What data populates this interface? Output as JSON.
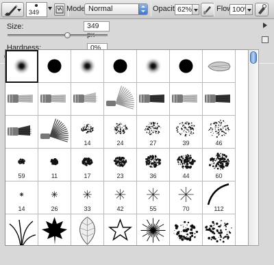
{
  "toolbar": {
    "tool_icon": "brush-icon",
    "brush_size_preview": "349",
    "mode_label": "Mode:",
    "mode_value": "Normal",
    "opacity_label": "Opacity:",
    "opacity_value": "62%",
    "flow_label": "Flow:",
    "flow_value": "100%",
    "airbrush_icon": "airbrush-icon"
  },
  "panel": {
    "size_label": "Size:",
    "size_value": "349 px",
    "size_slider_level": 0.6,
    "hardness_label": "Hardness:",
    "hardness_value": "0%",
    "hardness_slider_level": 0.0
  },
  "brushes": [
    {
      "kind": "soft",
      "label": ""
    },
    {
      "kind": "hard",
      "label": ""
    },
    {
      "kind": "soft",
      "label": ""
    },
    {
      "kind": "hard",
      "label": ""
    },
    {
      "kind": "soft",
      "label": ""
    },
    {
      "kind": "hard",
      "label": ""
    },
    {
      "kind": "bristle-tip",
      "label": ""
    },
    {
      "kind": "flat-brush",
      "label": ""
    },
    {
      "kind": "flat-brush",
      "label": ""
    },
    {
      "kind": "angled-brush",
      "label": ""
    },
    {
      "kind": "fan-brush",
      "label": ""
    },
    {
      "kind": "flat-brush-dark",
      "label": ""
    },
    {
      "kind": "flat-brush",
      "label": ""
    },
    {
      "kind": "flat-brush-dark",
      "label": ""
    },
    {
      "kind": "angled-brush-dark",
      "label": ""
    },
    {
      "kind": "fan-brush-dark",
      "label": ""
    },
    {
      "kind": "spray",
      "label": "14"
    },
    {
      "kind": "spray",
      "label": "24"
    },
    {
      "kind": "spray",
      "label": "27"
    },
    {
      "kind": "spray",
      "label": "39"
    },
    {
      "kind": "spray",
      "label": "46"
    },
    {
      "kind": "spray",
      "label": "59"
    },
    {
      "kind": "chalk",
      "label": "11"
    },
    {
      "kind": "chalk",
      "label": "17"
    },
    {
      "kind": "chalk",
      "label": "23"
    },
    {
      "kind": "chalk",
      "label": "36"
    },
    {
      "kind": "chalk",
      "label": "44"
    },
    {
      "kind": "chalk",
      "label": "60"
    },
    {
      "kind": "star",
      "label": "14"
    },
    {
      "kind": "star",
      "label": "26"
    },
    {
      "kind": "star",
      "label": "33"
    },
    {
      "kind": "star",
      "label": "42"
    },
    {
      "kind": "star",
      "label": "55"
    },
    {
      "kind": "star",
      "label": "70"
    },
    {
      "kind": "arc",
      "label": "112"
    },
    {
      "kind": "grass",
      "label": ""
    },
    {
      "kind": "maple-leaf",
      "label": ""
    },
    {
      "kind": "leaf",
      "label": ""
    },
    {
      "kind": "star-outline",
      "label": ""
    },
    {
      "kind": "burst",
      "label": ""
    },
    {
      "kind": "splatter",
      "label": ""
    },
    {
      "kind": "splatter2",
      "label": ""
    }
  ]
}
